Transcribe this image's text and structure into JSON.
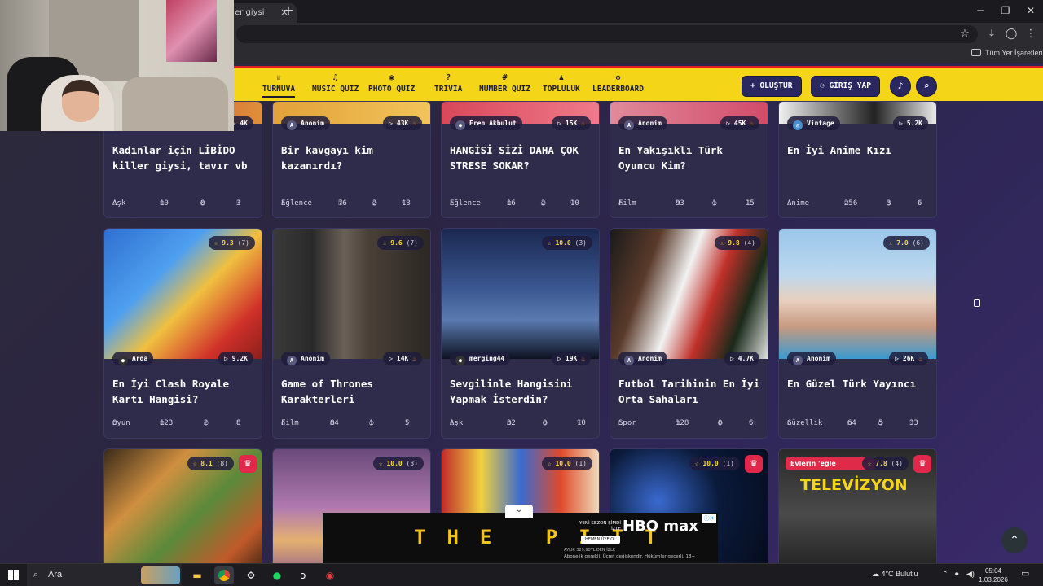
{
  "browser": {
    "tab_title": "er giysi",
    "bookmark": "Tüm Yer İşaretleri"
  },
  "colors": {
    "nav_bg": "#f5d517",
    "nav_top_border": "#e02020",
    "card_bg": "#2e2c4a",
    "rating": "#f6d743",
    "crown": "#e1284a"
  },
  "nav": {
    "items": [
      {
        "icon": "trophy-icon",
        "label": "TURNUVA",
        "glyph": "♕"
      },
      {
        "icon": "music-icon",
        "label": "MUSIC QUIZ",
        "glyph": "♫"
      },
      {
        "icon": "camera-icon",
        "label": "PHOTO QUIZ",
        "glyph": "◉"
      },
      {
        "icon": "question-icon",
        "label": "TRIVIA",
        "glyph": "?"
      },
      {
        "icon": "hash-icon",
        "label": "NUMBER QUIZ",
        "glyph": "#"
      },
      {
        "icon": "users-icon",
        "label": "TOPLULUK",
        "glyph": "♟"
      },
      {
        "icon": "medal-icon",
        "label": "LEADERBOARD",
        "glyph": "✪"
      }
    ],
    "create_label": "OLUŞTUR",
    "login_label": "GİRİŞ YAP"
  },
  "cards_row1": [
    {
      "author": "",
      "plays": "4K",
      "hot": false,
      "title": "Kadınlar için LİBİDO killer giysi, tavır vb",
      "category": "Aşk",
      "items": "10",
      "comments": "0",
      "likes": "3"
    },
    {
      "author": "Anonim",
      "plays": "43K",
      "hot": true,
      "title": "Bir kavgayı kim kazanırdı?",
      "category": "Eğlence",
      "items": "76",
      "comments": "2",
      "likes": "13"
    },
    {
      "author": "Eren Akbulut",
      "plays": "15K",
      "hot": true,
      "title": "HANGİSİ SİZİ DAHA ÇOK STRESE SOKAR?",
      "category": "Eğlence",
      "items": "16",
      "comments": "2",
      "likes": "10"
    },
    {
      "author": "Anonim",
      "plays": "45K",
      "hot": true,
      "title": "En Yakışıklı Türk Oyuncu Kim?",
      "category": "Film",
      "items": "93",
      "comments": "1",
      "likes": "15"
    },
    {
      "author": "Vintage",
      "plays": "5.2K",
      "hot": false,
      "title": "En İyi Anime Kızı",
      "category": "Anime",
      "items": "256",
      "comments": "3",
      "likes": "6"
    }
  ],
  "cards_row2": [
    {
      "rating": "9.3",
      "votes": "(7)",
      "author": "Arda",
      "plays": "9.2K",
      "hot": false,
      "title": "En İyi Clash Royale Kartı Hangisi?",
      "category": "Oyun",
      "items": "123",
      "comments": "2",
      "likes": "8"
    },
    {
      "rating": "9.6",
      "votes": "(7)",
      "author": "Anonim",
      "plays": "14K",
      "hot": true,
      "title": "Game of Thrones Karakterleri",
      "category": "Film",
      "items": "84",
      "comments": "1",
      "likes": "5"
    },
    {
      "rating": "10.0",
      "votes": "(3)",
      "author": "merging44",
      "plays": "19K",
      "hot": true,
      "title": "Sevgilinle Hangisini Yapmak İsterdin?",
      "category": "Aşk",
      "items": "32",
      "comments": "0",
      "likes": "10"
    },
    {
      "rating": "9.8",
      "votes": "(4)",
      "author": "Anonim",
      "plays": "4.7K",
      "hot": false,
      "title": "Futbol Tarihinin En İyi Orta Sahaları",
      "category": "Spor",
      "items": "128",
      "comments": "0",
      "likes": "6"
    },
    {
      "rating": "7.0",
      "votes": "(6)",
      "author": "Anonim",
      "plays": "26K",
      "hot": true,
      "title": "En Güzel Türk Yayıncı",
      "category": "Güzellik",
      "items": "64",
      "comments": "5",
      "likes": "33"
    }
  ],
  "cards_row3": [
    {
      "rating": "8.1",
      "votes": "(8)",
      "crown": true,
      "overlay": ""
    },
    {
      "rating": "10.0",
      "votes": "(3)",
      "crown": false,
      "overlay": ""
    },
    {
      "rating": "10.0",
      "votes": "(1)",
      "crown": false,
      "overlay": ""
    },
    {
      "rating": "10.0",
      "votes": "(1)",
      "crown": true,
      "overlay": ""
    },
    {
      "rating": "7.8",
      "votes": "(4)",
      "crown": true,
      "overlay": "TELEVİZYON",
      "overlay_top": "Evlerin 'eğle"
    }
  ],
  "ad": {
    "show": "THE PITT",
    "brand": "HBO max",
    "headline": "YENİ SEZON ŞİMDİ İZLE",
    "cta": "HEMEN ÜYE OL",
    "price": "AYLIK 329,90TL'DEN İZLE",
    "fine": "Abonelik gerekli. Ücret değişkendir. Hükümler geçerli. 18+"
  },
  "taskbar": {
    "search_placeholder": "Ara",
    "weather": "4°C  Bulutlu",
    "time": "05:04",
    "date": "1.03.2026"
  }
}
